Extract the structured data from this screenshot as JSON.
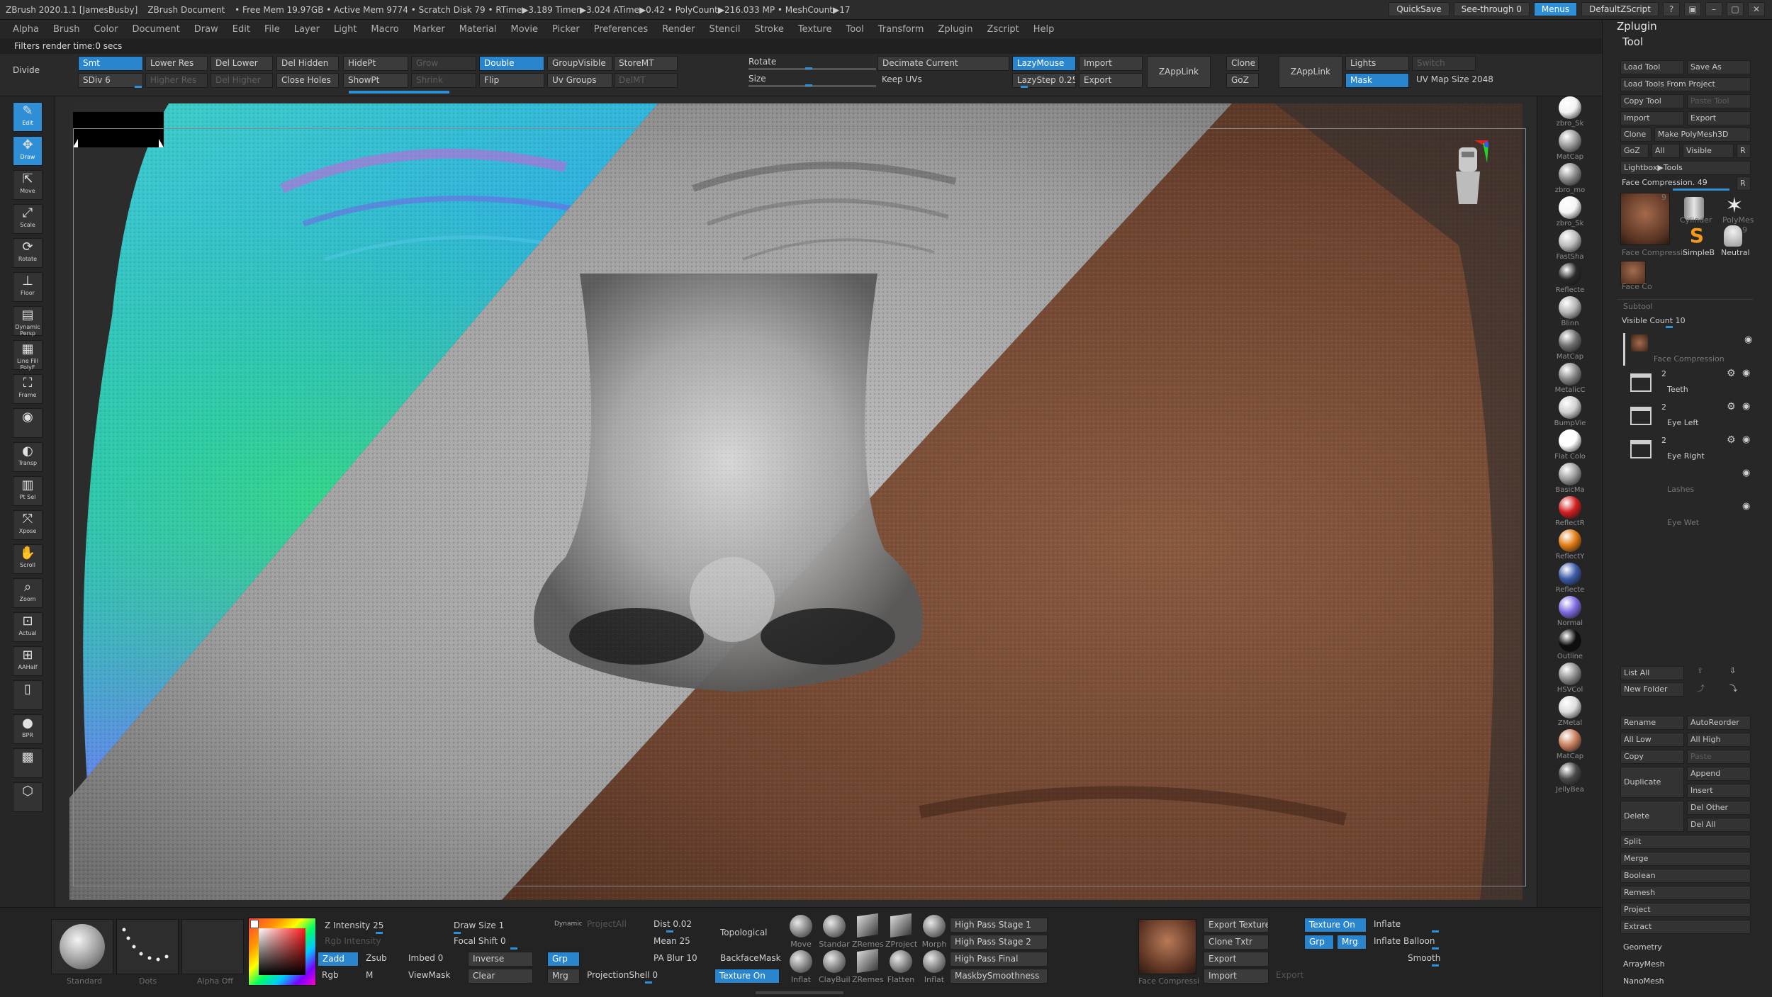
{
  "titlebar": {
    "items": [
      "ZBrush 2020.1.1 [JamesBusby]",
      "ZBrush Document",
      "• Free Mem 19.97GB • Active Mem 9774 • Scratch Disk 79 • RTime▶3.189 Timer▶3.024 ATime▶0.42 • PolyCount▶216.033 MP • MeshCount▶17"
    ],
    "quicksave": "QuickSave",
    "see_through": "See-through  0",
    "menus": "Menus",
    "zscript": "DefaultZScript"
  },
  "menubar": [
    "Alpha",
    "Brush",
    "Color",
    "Document",
    "Draw",
    "Edit",
    "File",
    "Layer",
    "Light",
    "Macro",
    "Marker",
    "Material",
    "Movie",
    "Picker",
    "Preferences",
    "Render",
    "Stencil",
    "Stroke",
    "Texture",
    "Tool",
    "Transform",
    "Zplugin",
    "Zscript",
    "Help"
  ],
  "infobar": "Filters render time:0 secs",
  "topshelf": {
    "divide": "Divide",
    "smt": "Smt",
    "sdiv": "SDiv 6",
    "lower_res": "Lower Res",
    "higher_res": "Higher Res",
    "del_lower": "Del Lower",
    "del_higher": "Del Higher",
    "del_hidden": "Del Hidden",
    "close_holes": "Close Holes",
    "hidept": "HidePt",
    "showpt": "ShowPt",
    "grow": "Grow",
    "shrink": "Shrink",
    "double": "Double",
    "flip": "Flip",
    "groupvisible": "GroupVisible",
    "uv_groups": "Uv Groups",
    "storemt": "StoreMT",
    "delmt": "DelMT",
    "rotate": "Rotate",
    "size": "Size",
    "decimate": "Decimate Current",
    "keep_uvs": "Keep UVs",
    "lazymouse": "LazyMouse",
    "lazystep": "LazyStep 0.25",
    "import": "Import",
    "export": "Export",
    "zapplink1": "ZAppLink",
    "clone": "Clone",
    "goz": "GoZ",
    "zapplink2": "ZAppLink",
    "lights": "Lights",
    "switch": "Switch",
    "mask": "Mask",
    "uv_map_size": "UV Map Size 2048"
  },
  "lefttools": [
    {
      "name": "edit",
      "glyph": "✎",
      "label": "Edit",
      "active": true
    },
    {
      "name": "draw",
      "glyph": "✥",
      "label": "Draw",
      "active": true
    },
    {
      "name": "move",
      "glyph": "⇱",
      "label": "Move"
    },
    {
      "name": "scale",
      "glyph": "⤢",
      "label": "Scale"
    },
    {
      "name": "rotate",
      "glyph": "⟳",
      "label": "Rotate"
    },
    {
      "name": "floor",
      "glyph": "⊥",
      "label": "Floor"
    },
    {
      "name": "persp",
      "glyph": "▤",
      "label": "Dynamic Persp"
    },
    {
      "name": "polyf",
      "glyph": "▦",
      "label": "Line Fill PolyF"
    },
    {
      "name": "frame",
      "glyph": "⛶",
      "label": "Frame"
    },
    {
      "name": "snapshot",
      "glyph": "◉",
      "label": ""
    },
    {
      "name": "transp",
      "glyph": "◐",
      "label": "Transp"
    },
    {
      "name": "ptsel",
      "glyph": "▥",
      "label": "Pt Sel"
    },
    {
      "name": "xpose",
      "glyph": "⤧",
      "label": "Xpose"
    },
    {
      "name": "scroll",
      "glyph": "✋",
      "label": "Scroll"
    },
    {
      "name": "zoom",
      "glyph": "⌕",
      "label": "Zoom"
    },
    {
      "name": "actual",
      "glyph": "⊡",
      "label": "Actual"
    },
    {
      "name": "aahalf",
      "glyph": "⊞",
      "label": "AAHalf"
    },
    {
      "name": "ghost",
      "glyph": "▯",
      "label": ""
    },
    {
      "name": "bpr",
      "glyph": "●",
      "label": "BPR"
    },
    {
      "name": "sketch",
      "glyph": "▩",
      "label": ""
    },
    {
      "name": "cube",
      "glyph": "⬡",
      "label": ""
    }
  ],
  "materials": [
    {
      "label": "zbro_Sk",
      "color": "#f2f2f2"
    },
    {
      "label": "MatCap",
      "color": "#9a9a9a"
    },
    {
      "label": "zbro_mo",
      "color": "#8a8a8a"
    },
    {
      "label": "zbro_Sk",
      "color": "#f5f5f5"
    },
    {
      "label": "FastSha",
      "color": "#bbbbbb"
    },
    {
      "label": "Reflecte",
      "color": "#2a2a2a"
    },
    {
      "label": "Blinn",
      "color": "#b5b5b5"
    },
    {
      "label": "MatCap",
      "color": "#6f6f6f"
    },
    {
      "label": "MetalicC",
      "color": "#888888"
    },
    {
      "label": "BumpVie",
      "color": "#d0d0d0"
    },
    {
      "label": "Flat Colo",
      "color": "#ffffff"
    },
    {
      "label": "BasicMa",
      "color": "#9d9d9d"
    },
    {
      "label": "ReflectR",
      "color": "#d21f1f"
    },
    {
      "label": "ReflectY",
      "color": "#e07a12"
    },
    {
      "label": "Reflecte",
      "color": "#3b5aa8"
    },
    {
      "label": "Normal",
      "color": "#7d6be0"
    },
    {
      "label": "Outline",
      "color": "#0d0d0d"
    },
    {
      "label": "HSVCol",
      "color": "#8e8e8e"
    },
    {
      "label": "ZMetal",
      "color": "#dcdcdc"
    },
    {
      "label": "MatCap",
      "color": "#c87e5c"
    },
    {
      "label": "JellyBea",
      "color": "#4a4a4a"
    }
  ],
  "rightpanel": {
    "zplugin": "Zplugin",
    "tool": "Tool",
    "load_tool": "Load Tool",
    "save_as": "Save As",
    "load_from_project": "Load Tools From Project",
    "copy_tool": "Copy Tool",
    "paste_tool": "Paste Tool",
    "import": "Import",
    "export": "Export",
    "clone": "Clone",
    "make_polymesh": "Make PolyMesh3D",
    "goz": "GoZ",
    "all": "All",
    "visible": "Visible",
    "r": "R",
    "lightbox_tools": "Lightbox▶Tools",
    "face_compression": "Face Compression. 49",
    "thumb_labels": [
      "Face Compressio",
      "Cylinder",
      "PolyMes",
      "SimpleB",
      "Neutral",
      "Face Co"
    ],
    "thumb_counts": [
      "9",
      "9"
    ],
    "subtool": "Subtool",
    "visible_count": "Visible Count 10",
    "subtools": [
      {
        "name": "Face Compression",
        "count": ""
      },
      {
        "name": "Teeth",
        "count": "2"
      },
      {
        "name": "Eye Left",
        "count": "2"
      },
      {
        "name": "Eye Right",
        "count": "2"
      },
      {
        "name": "Lashes",
        "count": ""
      },
      {
        "name": "Eye Wet",
        "count": ""
      }
    ],
    "list_all": "List All",
    "new_folder": "New Folder",
    "rename": "Rename",
    "autoreorder": "AutoReorder",
    "all_low": "All Low",
    "all_high": "All High",
    "copy": "Copy",
    "paste": "Paste",
    "duplicate": "Duplicate",
    "append": "Append",
    "insert": "Insert",
    "delete": "Delete",
    "del_other": "Del Other",
    "del_all": "Del All",
    "split": "Split",
    "merge": "Merge",
    "boolean": "Boolean",
    "remesh": "Remesh",
    "project": "Project",
    "extract": "Extract",
    "geometry": "Geometry",
    "arraymesh": "ArrayMesh",
    "nanomesh": "NanoMesh"
  },
  "bottomshelf": {
    "brush_label": "Standard",
    "stroke_label": "Dots",
    "alpha_label": "Alpha Off",
    "z_intensity": "Z Intensity 25",
    "rgb_intensity": "Rgb Intensity",
    "zadd": "Zadd",
    "zsub": "Zsub",
    "rgb": "Rgb",
    "m": "M",
    "draw_size": "Draw Size 1",
    "dynamic": "Dynamic",
    "focal_shift": "Focal Shift 0",
    "imbed": "Imbed 0",
    "inverse": "Inverse",
    "viewmask": "ViewMask",
    "clear": "Clear",
    "project_all": "ProjectAll",
    "grp1": "Grp",
    "mrg1": "Mrg",
    "dist": "Dist 0.02",
    "mean": "Mean 25",
    "pa_blur": "PA Blur 10",
    "projection_shell": "ProjectionShell 0",
    "topological": "Topological",
    "backfacemask": "BackfaceMask",
    "texture_on1": "Texture On",
    "brushes": [
      "Move",
      "Standar",
      "ZRemes",
      "ZProject",
      "Morph",
      "Inflat",
      "ClayBuil",
      "ZRemes",
      "Flatten",
      "Inflat"
    ],
    "hp1": "High Pass Stage 1",
    "hp2": "High Pass Stage 2",
    "hpf": "High Pass Final",
    "masksmooth": "MaskbySmoothness",
    "face_thumb_label": "Face Compressi",
    "export_texture": "Export Texture",
    "clone_txtr": "Clone Txtr",
    "export": "Export",
    "import": "Import",
    "export_dim": "Export",
    "texture_on2": "Texture On",
    "grp2": "Grp",
    "mrg2": "Mrg",
    "inflate": "Inflate",
    "inflate_balloon": "Inflate Balloon",
    "smooth": "Smooth"
  }
}
